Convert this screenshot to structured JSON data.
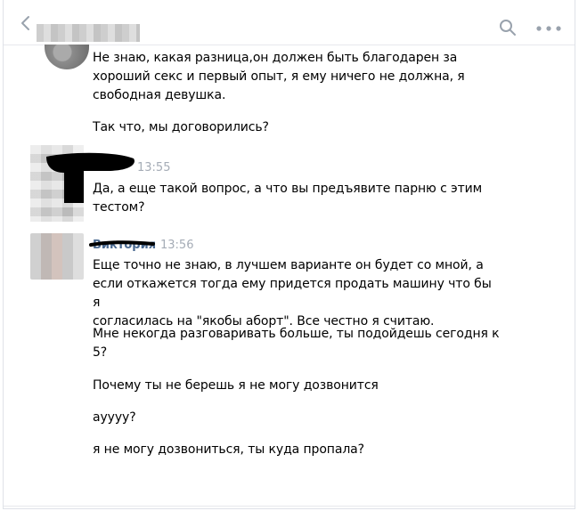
{
  "header": {
    "back_icon": "chevron-left-icon",
    "search_icon": "search-icon",
    "more_icon": "more-icon"
  },
  "messages": [
    {
      "lines": [
        "Не знаю, какая разница,он должен быть благодарен за",
        "хороший секс и первый опыт, я ему ничего не должна, я",
        "свободная девушка."
      ],
      "extra": "Так что, мы договорились?"
    },
    {
      "time": "13:55",
      "lines": [
        "Да, а еще такой вопрос, а что вы предъявите парню с этим",
        "тестом?"
      ]
    },
    {
      "name": "Виктория",
      "time": "13:56",
      "p1": [
        "Еще точно не знаю, в лучшем варианте он будет со мной, а",
        "если откажется тогда ему придется продать машину что бы я",
        "согласилась на \"якобы аборт\". Все честно я считаю."
      ],
      "p2": [
        "Мне некогда разговаривать больше, ты подойдешь сегодня к",
        "5?"
      ],
      "p3": "Почему ты не берешь я не могу дозвонится",
      "p4": "ayyyy?",
      "p5": "я не могу дозвониться, ты куда пропала?"
    }
  ],
  "colors": {
    "time": "#a5acb6",
    "name": "#4b6a91",
    "icon": "#99a2ad"
  }
}
